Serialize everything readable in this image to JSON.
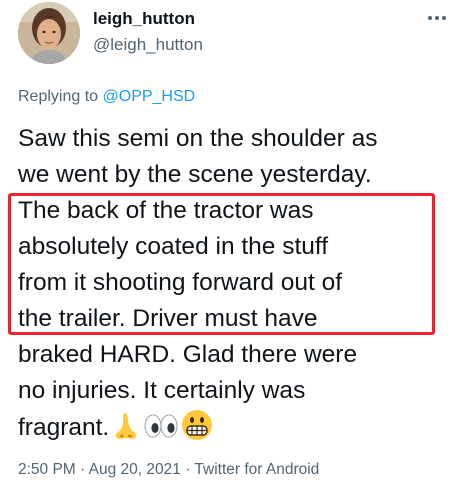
{
  "user": {
    "display_name": "leigh_hutton",
    "handle": "@leigh_hutton"
  },
  "reply": {
    "prefix": "Replying to ",
    "target": "@OPP_HSD"
  },
  "tweet": {
    "lines": [
      "Saw this semi on the shoulder as",
      "we went by the scene yesterday.",
      "The back of the tractor was",
      "absolutely coated in the stuff",
      "from it shooting forward out of",
      "the trailer.  Driver must have",
      "braked HARD.  Glad there were",
      "no injuries.  It certainly was",
      "fragrant."
    ],
    "emojis": [
      "nose-emoji",
      "eyes-emoji",
      "grimacing-face-emoji"
    ]
  },
  "meta": {
    "time": "2:50 PM",
    "separator": " · ",
    "date": "Aug 20, 2021",
    "source": "Twitter for Android"
  },
  "colors": {
    "text": "#0f1419",
    "secondary": "#536471",
    "link": "#1d9bf0",
    "highlight": "#e8252e"
  }
}
